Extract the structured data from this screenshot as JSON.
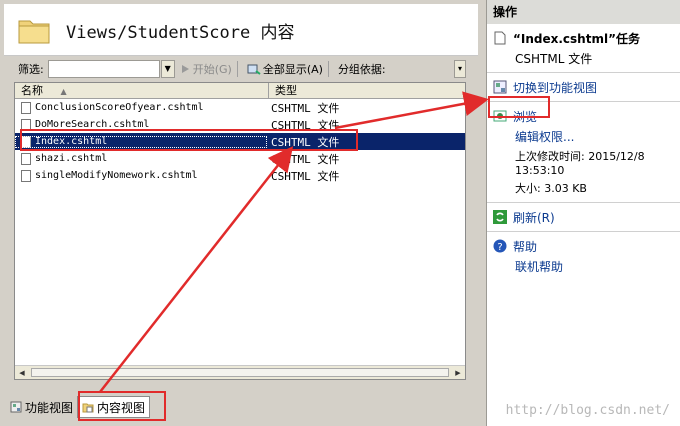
{
  "header": {
    "title": "Views/StudentScore 内容"
  },
  "toolbar": {
    "filter_label": "筛选:",
    "filter_value": "",
    "start_label": "开始(G)",
    "show_all_label": "全部显示(A)",
    "group_label": "分组依据:"
  },
  "list": {
    "columns": [
      "名称",
      "类型"
    ],
    "rows": [
      {
        "name": "ConclusionScoreOfyear.cshtml",
        "type": "CSHTML 文件",
        "selected": false
      },
      {
        "name": "DoMoreSearch.cshtml",
        "type": "CSHTML 文件",
        "selected": false
      },
      {
        "name": "Index.cshtml",
        "type": "CSHTML 文件",
        "selected": true
      },
      {
        "name": "shazi.cshtml",
        "type": "CSHTML 文件",
        "selected": false
      },
      {
        "name": "singleModifyNomework.cshtml",
        "type": "CSHTML 文件",
        "selected": false
      }
    ]
  },
  "bottom_tabs": [
    {
      "label": "功能视图",
      "active": false
    },
    {
      "label": "内容视图",
      "active": true
    }
  ],
  "actions": {
    "header": "操作",
    "file_title": "“Index.cshtml”任务",
    "file_type": "CSHTML 文件",
    "switch_view": "切换到功能视图",
    "browse": "浏览",
    "edit_permissions": "编辑权限...",
    "modified_label": "上次修改时间: 2015/12/8",
    "modified_time": "13:53:10",
    "size_label": "大小: 3.03 KB",
    "refresh": "刷新(R)",
    "help": "帮助",
    "online_help": "联机帮助"
  },
  "watermark": "http://blog.csdn.net/",
  "colors": {
    "selection": "#0a246a",
    "link": "#0b3a8f",
    "annotation": "#e12b2b"
  }
}
